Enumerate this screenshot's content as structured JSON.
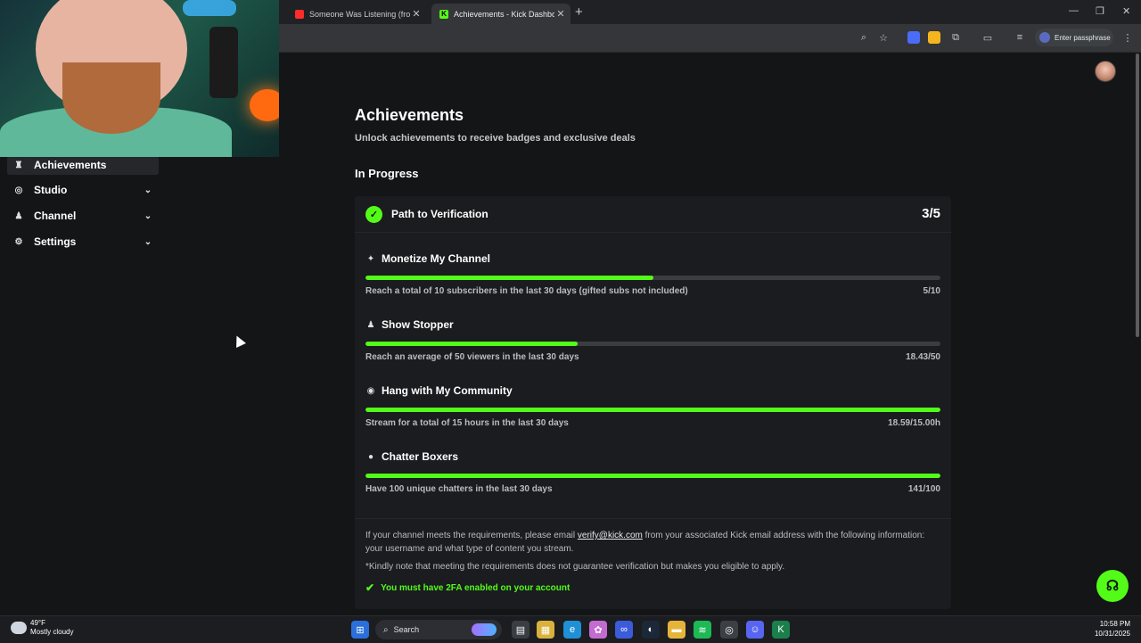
{
  "browser": {
    "tabs": [
      {
        "title": "Someone Was Listening (from I",
        "active": false
      },
      {
        "title": "Achievements - Kick Dashboard",
        "active": true
      }
    ],
    "profile_label": "Enter passphrase"
  },
  "sidebar": {
    "items": [
      {
        "label": "Achievements",
        "icon": "trophy-icon",
        "active": true
      },
      {
        "label": "Studio",
        "icon": "studio-icon",
        "expandable": true
      },
      {
        "label": "Channel",
        "icon": "channel-icon",
        "expandable": true
      },
      {
        "label": "Settings",
        "icon": "gear-icon",
        "expandable": true
      }
    ]
  },
  "page": {
    "title": "Achievements",
    "subtitle": "Unlock achievements to receive badges and exclusive deals",
    "section": "In Progress"
  },
  "card": {
    "title": "Path to Verification",
    "count": "3/5",
    "achievements": [
      {
        "name": "Monetize My Channel",
        "icon": "sparkle-icon",
        "desc": "Reach a total of 10 subscribers in the last 30 days (gifted subs not included)",
        "value": "5/10",
        "progress": 0.5
      },
      {
        "name": "Show Stopper",
        "icon": "viewers-icon",
        "desc": "Reach an average of 50 viewers in the last 30 days",
        "value": "18.43/50",
        "progress": 0.3686
      },
      {
        "name": "Hang with My Community",
        "icon": "broadcast-icon",
        "desc": "Stream for a total of 15 hours in the last 30 days",
        "value": "18.59/15.00h",
        "progress": 1.0
      },
      {
        "name": "Chatter Boxers",
        "icon": "chat-bubble-icon",
        "desc": "Have 100 unique chatters in the last 30 days",
        "value": "141/100",
        "progress": 1.0
      }
    ],
    "note_before_email": "If your channel meets the requirements, please email ",
    "note_email": "verify@kick.com",
    "note_after_email": " from your associated Kick email address with the following information: your username and what type of content you stream.",
    "note_disclaimer": "*Kindly note that meeting the requirements does not guarantee verification but makes you eligible to apply.",
    "requirement": "You must have 2FA enabled on your account"
  },
  "taskbar": {
    "temperature": "49°F",
    "weather": "Mostly cloudy",
    "search_label": "Search",
    "time": "10:58 PM",
    "date": "10/31/2025"
  },
  "colors": {
    "accent": "#53fc18",
    "background": "#141517",
    "card": "#1a1c1f",
    "track": "#3a3c40"
  }
}
